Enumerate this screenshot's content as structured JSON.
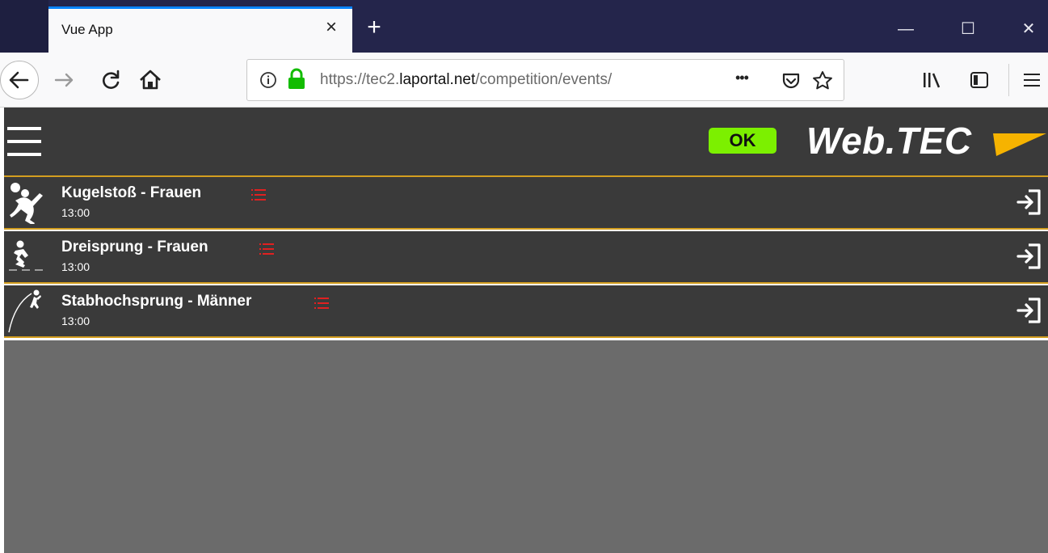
{
  "browser": {
    "tab_title": "Vue App",
    "tab_close": "×",
    "new_tab": "+",
    "window_controls": {
      "minimize": "—",
      "maximize": "☐",
      "close": "✕"
    },
    "url": {
      "scheme": "https://",
      "subdomain": "tec2.",
      "domain": "laportal.net",
      "path": "/competition/events/"
    },
    "icons": [
      "back-icon",
      "forward-icon",
      "reload-icon",
      "home-icon",
      "info-icon",
      "lock-icon",
      "page-actions-icon",
      "pocket-icon",
      "bookmark-star-icon",
      "library-icon",
      "sidebar-icon",
      "menu-icon"
    ],
    "more_glyph": "•••"
  },
  "app": {
    "status_label": "OK",
    "brand": "Web.TEC",
    "colors": {
      "accent": "#d39e1f",
      "status_ok": "#7cf000",
      "panel": "#3a3a3a",
      "background": "#6b6b6b",
      "list_icon": "#e02020",
      "logo": "#f6b300"
    },
    "events": [
      {
        "name": "Kugelstoß - Frauen",
        "time": "13:00",
        "icon": "shot-put-icon"
      },
      {
        "name": "Dreisprung - Frauen",
        "time": "13:00",
        "icon": "triple-jump-icon"
      },
      {
        "name": "Stabhochsprung - Männer",
        "time": "13:00",
        "icon": "pole-vault-icon"
      }
    ]
  }
}
